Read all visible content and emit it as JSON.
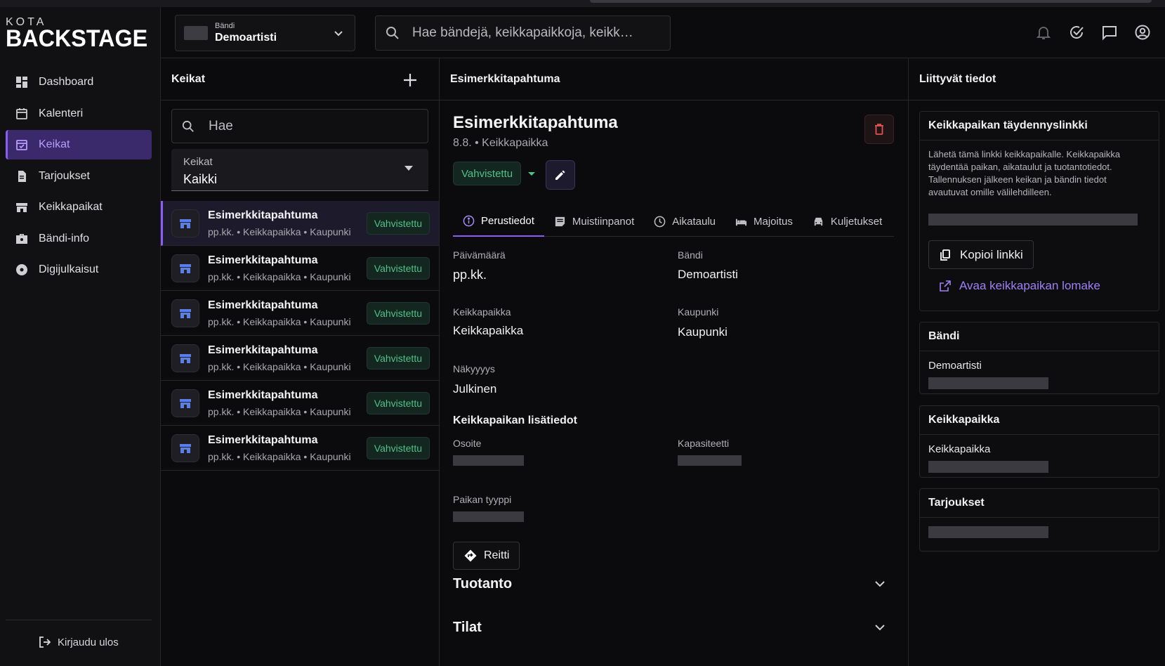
{
  "app": {
    "logo_small": "KOTA",
    "logo_big": "BACKSTAGE",
    "accent": "#8b5cf6",
    "success": "#4fc28a",
    "danger": "#e05353"
  },
  "sidebar": {
    "items": [
      {
        "label": "Dashboard",
        "icon": "dashboard-icon"
      },
      {
        "label": "Kalenteri",
        "icon": "calendar-icon"
      },
      {
        "label": "Keikat",
        "icon": "event-icon",
        "active": true
      },
      {
        "label": "Tarjoukset",
        "icon": "offer-icon"
      },
      {
        "label": "Keikkapaikat",
        "icon": "venue-icon"
      },
      {
        "label": "Bändi-info",
        "icon": "briefcase-icon"
      },
      {
        "label": "Digijulkaisut",
        "icon": "disc-icon"
      }
    ],
    "logout": "Kirjaudu ulos"
  },
  "header": {
    "band_label": "Bändi",
    "band_value": "Demoartisti",
    "search_placeholder": "Hae bändejä, keikkapaikkoja, keikk…",
    "icons": [
      "bell-icon",
      "check-circle-icon",
      "chat-icon",
      "account-icon"
    ]
  },
  "list": {
    "title": "Keikat",
    "search_placeholder": "Hae",
    "filter_label": "Keikat",
    "filter_value": "Kaikki",
    "rows": [
      {
        "title": "Esimerkkitapahtuma",
        "sub": "pp.kk. • Keikkapaikka • Kaupunki",
        "status": "Vahvistettu",
        "selected": true
      },
      {
        "title": "Esimerkkitapahtuma",
        "sub": "pp.kk. • Keikkapaikka • Kaupunki",
        "status": "Vahvistettu"
      },
      {
        "title": "Esimerkkitapahtuma",
        "sub": "pp.kk. • Keikkapaikka • Kaupunki",
        "status": "Vahvistettu"
      },
      {
        "title": "Esimerkkitapahtuma",
        "sub": "pp.kk. • Keikkapaikka • Kaupunki",
        "status": "Vahvistettu"
      },
      {
        "title": "Esimerkkitapahtuma",
        "sub": "pp.kk. • Keikkapaikka • Kaupunki",
        "status": "Vahvistettu"
      },
      {
        "title": "Esimerkkitapahtuma",
        "sub": "pp.kk. • Keikkapaikka • Kaupunki",
        "status": "Vahvistettu"
      }
    ]
  },
  "detail": {
    "column_title": "Esimerkkitapahtuma",
    "title": "Esimerkkitapahtuma",
    "subtitle": "8.8. • Keikkapaikka",
    "status": "Vahvistettu",
    "tabs": [
      {
        "label": "Perustiedot",
        "icon": "info-icon",
        "active": true
      },
      {
        "label": "Muistiinpanot",
        "icon": "notes-icon"
      },
      {
        "label": "Aikataulu",
        "icon": "clock-icon"
      },
      {
        "label": "Majoitus",
        "icon": "bed-icon"
      },
      {
        "label": "Kuljetukset",
        "icon": "car-icon"
      }
    ],
    "fields": {
      "date_label": "Päivämäärä",
      "date_value": "pp.kk.",
      "band_label": "Bändi",
      "band_value": "Demoartisti",
      "venue_label": "Keikkapaikka",
      "venue_value": "Keikkapaikka",
      "city_label": "Kaupunki",
      "city_value": "Kaupunki",
      "visibility_label": "Näkyyyys",
      "visibility_value": "Julkinen"
    },
    "venue_section": {
      "title": "Keikkapaikan lisätiedot",
      "address_label": "Osoite",
      "capacity_label": "Kapasiteetti",
      "type_label": "Paikan tyyppi"
    },
    "route_button": "Reitti",
    "accordions": [
      "Tuotanto",
      "Tilat"
    ]
  },
  "related": {
    "title": "Liittyvät tiedot",
    "link_card": {
      "title": "Keikkapaikan täydennyslinkki",
      "desc": "Lähetä tämä linkki keikkapaikalle. Keikkapaikka täydentää paikan, aikataulut ja tuotantotiedot. Tallennuksen jälkeen keikan ja bändin tiedot avautuvat omille välilehdilleen.",
      "copy": "Kopioi linkki",
      "open": "Avaa keikkapaikan lomake"
    },
    "band_card": {
      "title": "Bändi",
      "value": "Demoartisti"
    },
    "venue_card": {
      "title": "Keikkapaikka",
      "value": "Keikkapaikka"
    },
    "offers_card": {
      "title": "Tarjoukset"
    }
  }
}
